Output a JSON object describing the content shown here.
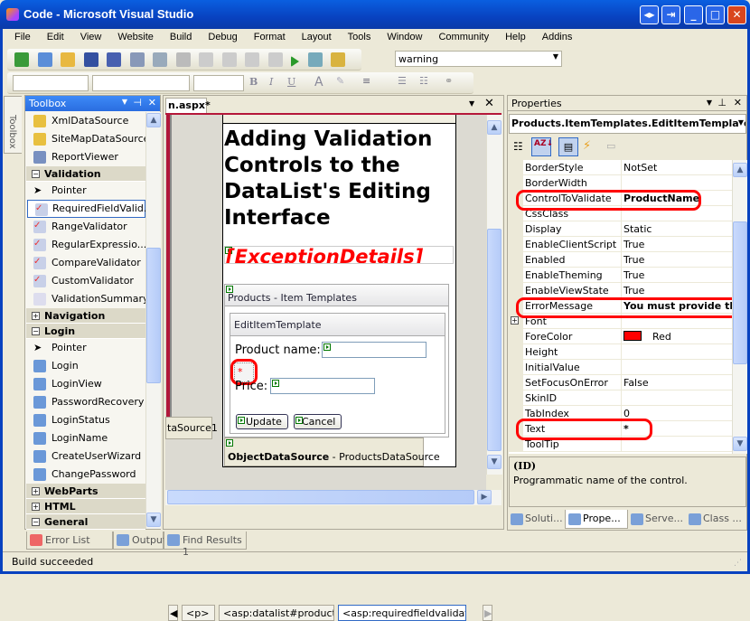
{
  "window": {
    "title": "Code - Microsoft Visual Studio"
  },
  "menu": [
    "File",
    "Edit",
    "View",
    "Website",
    "Build",
    "Debug",
    "Format",
    "Layout",
    "Tools",
    "Window",
    "Community",
    "Help",
    "Addins"
  ],
  "toolbar": {
    "find_value": "warning"
  },
  "toolbox": {
    "title": "Toolbox",
    "side_tab": "Toolbox",
    "entries": [
      {
        "type": "item",
        "label": "XmlDataSource",
        "icon": "xml-datasource-icon"
      },
      {
        "type": "item",
        "label": "SiteMapDataSource",
        "icon": "sitemap-datasource-icon"
      },
      {
        "type": "item",
        "label": "ReportViewer",
        "icon": "report-viewer-icon"
      },
      {
        "type": "cat",
        "label": "Validation",
        "expanded": true
      },
      {
        "type": "item",
        "label": "Pointer",
        "icon": "pointer-icon"
      },
      {
        "type": "item",
        "label": "RequiredFieldValid...",
        "icon": "validator-icon",
        "selected": true
      },
      {
        "type": "item",
        "label": "RangeValidator",
        "icon": "validator-icon"
      },
      {
        "type": "item",
        "label": "RegularExpressio...",
        "icon": "validator-icon"
      },
      {
        "type": "item",
        "label": "CompareValidator",
        "icon": "validator-icon"
      },
      {
        "type": "item",
        "label": "CustomValidator",
        "icon": "validator-icon"
      },
      {
        "type": "item",
        "label": "ValidationSummary",
        "icon": "validation-summary-icon"
      },
      {
        "type": "cat",
        "label": "Navigation",
        "expanded": false
      },
      {
        "type": "cat",
        "label": "Login",
        "expanded": true
      },
      {
        "type": "item",
        "label": "Pointer",
        "icon": "pointer-icon"
      },
      {
        "type": "item",
        "label": "Login",
        "icon": "login-icon"
      },
      {
        "type": "item",
        "label": "LoginView",
        "icon": "login-icon"
      },
      {
        "type": "item",
        "label": "PasswordRecovery",
        "icon": "login-icon"
      },
      {
        "type": "item",
        "label": "LoginStatus",
        "icon": "login-icon"
      },
      {
        "type": "item",
        "label": "LoginName",
        "icon": "login-icon"
      },
      {
        "type": "item",
        "label": "CreateUserWizard",
        "icon": "login-icon"
      },
      {
        "type": "item",
        "label": "ChangePassword",
        "icon": "login-icon"
      },
      {
        "type": "cat",
        "label": "WebParts",
        "expanded": false
      },
      {
        "type": "cat",
        "label": "HTML",
        "expanded": false
      },
      {
        "type": "cat",
        "label": "General",
        "expanded": true
      }
    ]
  },
  "editor": {
    "tab": "n.aspx*",
    "heading": "Adding Validation Controls to the DataList's Editing Interface",
    "exception_label": "[ExceptionDetails]",
    "datalist_header": "Products - Item Templates",
    "template_header": "EditItemTemplate",
    "product_name_label": "Product name:",
    "validator_text": "*",
    "price_label": "Price:",
    "update_button": "Update",
    "cancel_button": "Cancel",
    "ods_type": "ObjectDataSource",
    "ods_name": " - ProductsDataSource",
    "left_ods": "taSource1",
    "breadcrumbs": [
      "<p>",
      "<asp:datalist#products>",
      "<asp:requiredfieldvalidat...>"
    ]
  },
  "properties": {
    "title": "Properties",
    "object": "Products.ItemTemplates.EditItemTemplate",
    "rows": [
      {
        "name": "BorderStyle",
        "value": "NotSet"
      },
      {
        "name": "BorderWidth",
        "value": ""
      },
      {
        "name": "ControlToValidate",
        "value": "ProductName",
        "bold": true
      },
      {
        "name": "CssClass",
        "value": ""
      },
      {
        "name": "Display",
        "value": "Static"
      },
      {
        "name": "EnableClientScript",
        "value": "True"
      },
      {
        "name": "Enabled",
        "value": "True"
      },
      {
        "name": "EnableTheming",
        "value": "True"
      },
      {
        "name": "EnableViewState",
        "value": "True"
      },
      {
        "name": "ErrorMessage",
        "value": "You must provide the",
        "bold": true
      },
      {
        "name": "Font",
        "value": "",
        "expandable": true
      },
      {
        "name": "ForeColor",
        "value": "Red",
        "swatch": "#ff0000"
      },
      {
        "name": "Height",
        "value": ""
      },
      {
        "name": "InitialValue",
        "value": ""
      },
      {
        "name": "SetFocusOnError",
        "value": "False"
      },
      {
        "name": "SkinID",
        "value": ""
      },
      {
        "name": "TabIndex",
        "value": "0"
      },
      {
        "name": "Text",
        "value": "*",
        "bold": true
      },
      {
        "name": "ToolTip",
        "value": ""
      }
    ],
    "desc_title": "(ID)",
    "desc_text": "Programmatic name of the control.",
    "tabs": [
      "Soluti...",
      "Prope...",
      "Serve...",
      "Class ..."
    ]
  },
  "bottom_tabs": [
    "Error List",
    "Output",
    "Find Results 1"
  ],
  "status": "Build succeeded",
  "colors": {
    "highlight": "#ff0000",
    "title_bar": "#0842c0",
    "panel_active": "#2a6de0"
  }
}
